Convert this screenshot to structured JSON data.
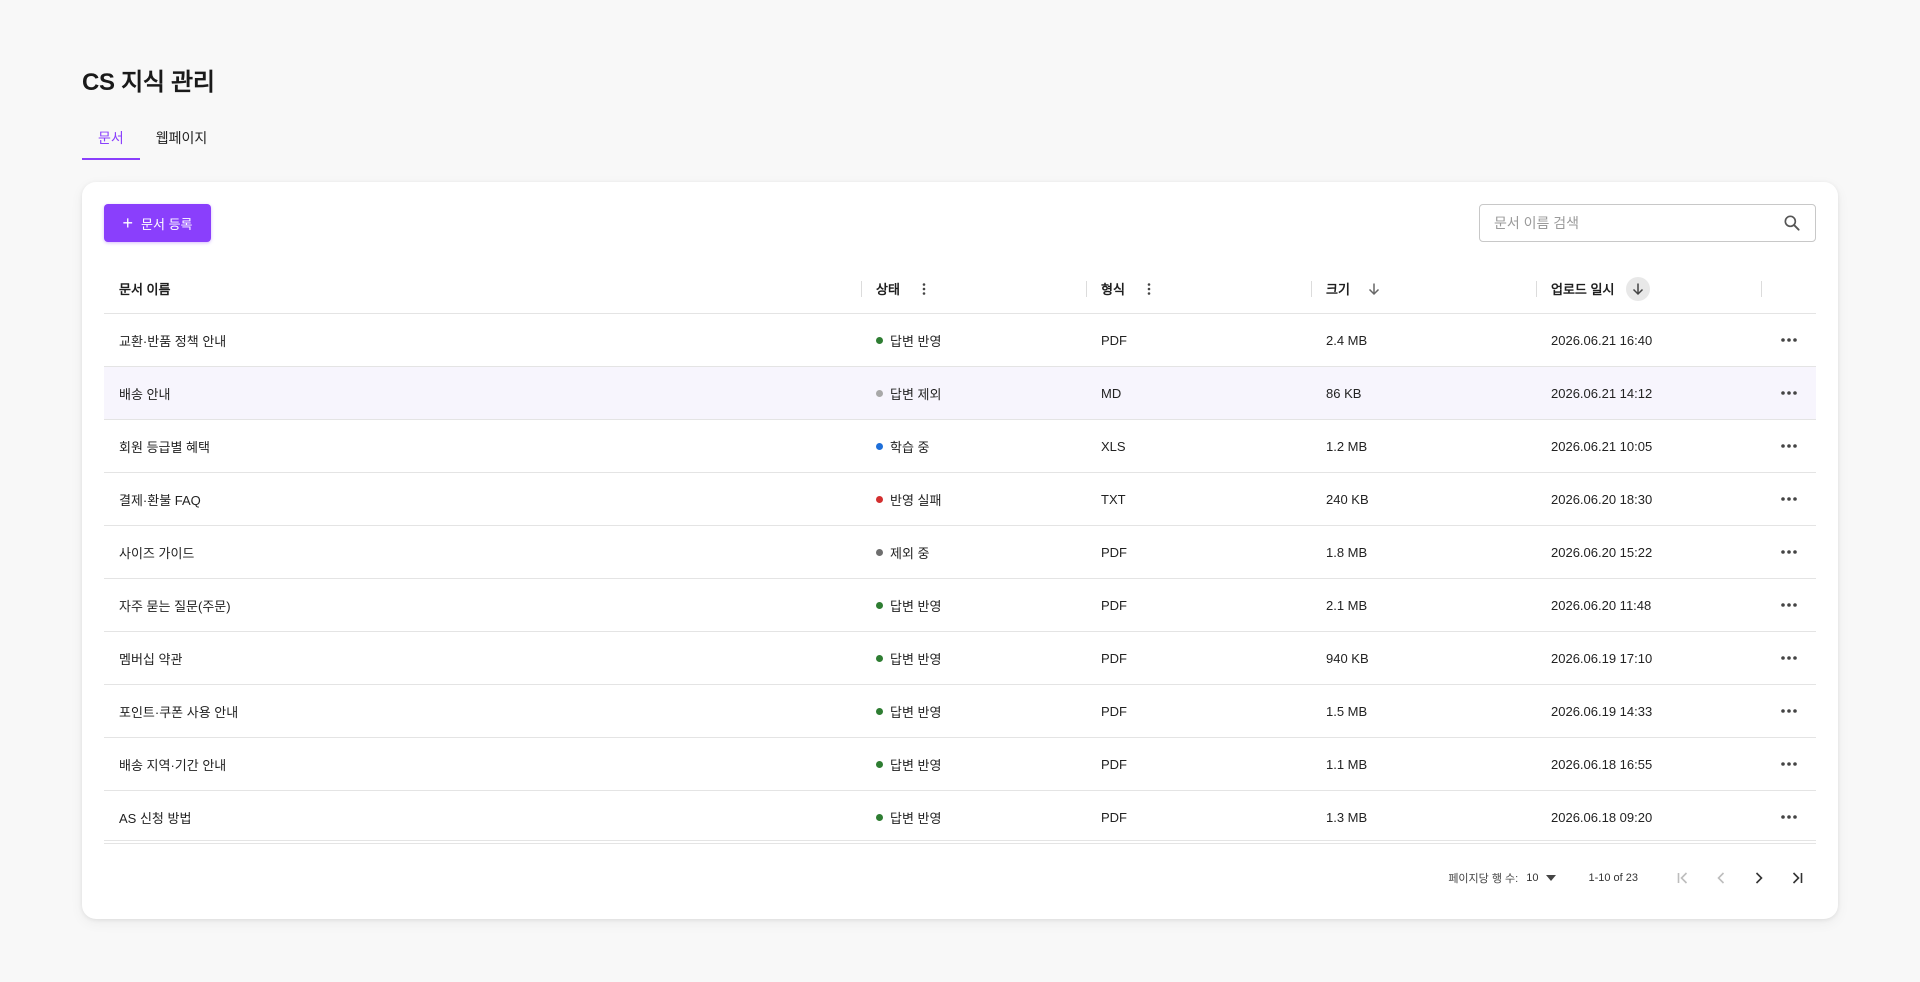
{
  "page": {
    "title": "CS 지식 관리"
  },
  "tabs": [
    {
      "label": "문서",
      "active": true
    },
    {
      "label": "웹페이지",
      "active": false
    }
  ],
  "toolbar": {
    "add_label": "문서 등록",
    "search_placeholder": "문서 이름 검색"
  },
  "table": {
    "columns": {
      "name": "문서 이름",
      "status": "상태",
      "format": "형식",
      "size": "크기",
      "uploaded": "업로드 일시"
    },
    "rows": [
      {
        "name": "교환·반품 정책 안내",
        "status": "답변 반영",
        "status_color": "#2e7d32",
        "format": "PDF",
        "size": "2.4 MB",
        "uploaded": "2026.06.21 16:40"
      },
      {
        "name": "배송 안내",
        "status": "답변 제외",
        "status_color": "#a8a8a8",
        "format": "MD",
        "size": "86 KB",
        "uploaded": "2026.06.21 14:12"
      },
      {
        "name": "회원 등급별 혜택",
        "status": "학습 중",
        "status_color": "#1e6fd9",
        "format": "XLS",
        "size": "1.2 MB",
        "uploaded": "2026.06.21 10:05"
      },
      {
        "name": "결제·환불 FAQ",
        "status": "반영 실패",
        "status_color": "#d32f2f",
        "format": "TXT",
        "size": "240 KB",
        "uploaded": "2026.06.20 18:30"
      },
      {
        "name": "사이즈 가이드",
        "status": "제외 중",
        "status_color": "#6e6e6e",
        "format": "PDF",
        "size": "1.8 MB",
        "uploaded": "2026.06.20 15:22"
      },
      {
        "name": "자주 묻는 질문(주문)",
        "status": "답변 반영",
        "status_color": "#2e7d32",
        "format": "PDF",
        "size": "2.1 MB",
        "uploaded": "2026.06.20 11:48"
      },
      {
        "name": "멤버십 약관",
        "status": "답변 반영",
        "status_color": "#2e7d32",
        "format": "PDF",
        "size": "940 KB",
        "uploaded": "2026.06.19 17:10"
      },
      {
        "name": "포인트·쿠폰 사용 안내",
        "status": "답변 반영",
        "status_color": "#2e7d32",
        "format": "PDF",
        "size": "1.5 MB",
        "uploaded": "2026.06.19 14:33"
      },
      {
        "name": "배송 지역·기간 안내",
        "status": "답변 반영",
        "status_color": "#2e7d32",
        "format": "PDF",
        "size": "1.1 MB",
        "uploaded": "2026.06.18 16:55"
      },
      {
        "name": "AS 신청 방법",
        "status": "답변 반영",
        "status_color": "#2e7d32",
        "format": "PDF",
        "size": "1.3 MB",
        "uploaded": "2026.06.18 09:20"
      }
    ]
  },
  "pagination": {
    "rows_per_page_label": "페이지당 행 수:",
    "rows_per_page": "10",
    "range": "1-10 of 23"
  },
  "colors": {
    "accent": "#8a3ffc",
    "highlight_row": "#f7f5fd"
  }
}
